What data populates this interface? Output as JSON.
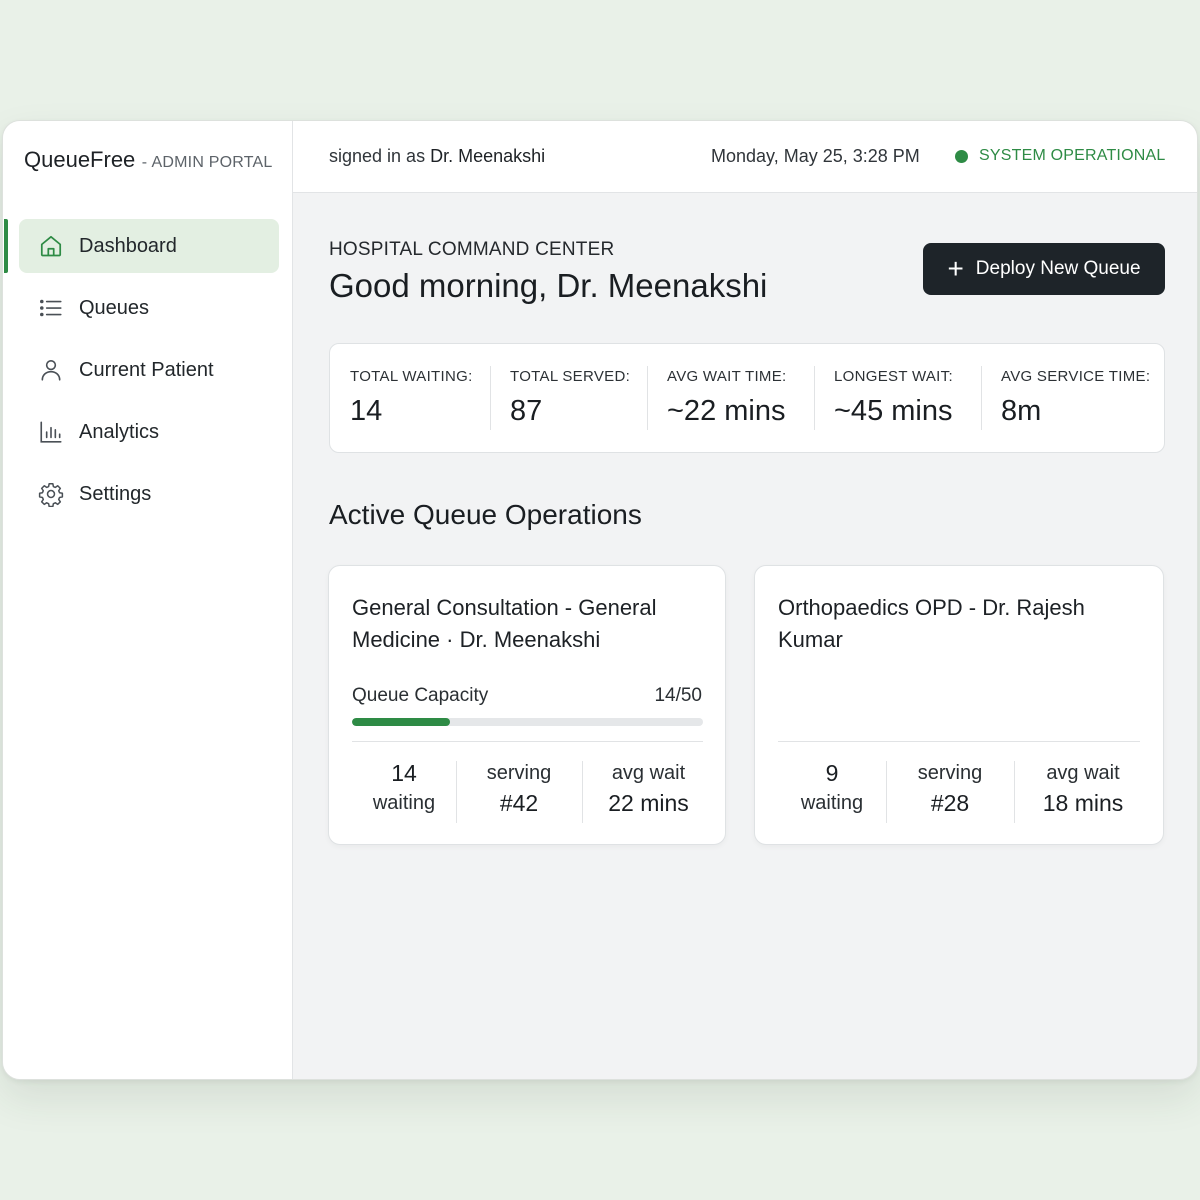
{
  "app": {
    "name": "QueueFree",
    "separator": "-",
    "portal": "ADMIN PORTAL"
  },
  "sidebar": {
    "items": [
      {
        "label": "Dashboard",
        "icon": "home-icon",
        "active": true
      },
      {
        "label": "Queues",
        "icon": "list-icon",
        "active": false
      },
      {
        "label": "Current Patient",
        "icon": "user-icon",
        "active": false
      },
      {
        "label": "Analytics",
        "icon": "bar-chart-icon",
        "active": false
      },
      {
        "label": "Settings",
        "icon": "gear-icon",
        "active": false
      }
    ]
  },
  "topbar": {
    "signed_prefix": "signed in as",
    "signed_user": "Dr. Meenakshi",
    "datetime": "Monday, May 25, 3:28 PM",
    "status": "SYSTEM OPERATIONAL"
  },
  "header": {
    "eyebrow": "HOSPITAL COMMAND CENTER",
    "greeting": "Good morning, Dr. Meenakshi",
    "deploy_label": "Deploy New Queue"
  },
  "stats": [
    {
      "label": "TOTAL WAITING:",
      "value": "14"
    },
    {
      "label": "TOTAL SERVED:",
      "value": "87"
    },
    {
      "label": "AVG WAIT TIME:",
      "value": "~22 mins"
    },
    {
      "label": "LONGEST WAIT:",
      "value": "~45 mins"
    },
    {
      "label": "AVG SERVICE TIME:",
      "value": "8m"
    }
  ],
  "section_title": "Active Queue Operations",
  "queues": [
    {
      "title": "General Consultation - General Medicine · Dr. Meenakshi",
      "capacity_label": "Queue Capacity",
      "capacity_value": "14/50",
      "capacity_fraction": 0.28,
      "waiting_count": "14",
      "waiting_label": "waiting",
      "serving_label": "serving",
      "serving_value": "#42",
      "avg_label": "avg wait",
      "avg_value": "22 mins"
    },
    {
      "title": "Orthopaedics OPD - Dr. Rajesh Kumar",
      "waiting_count": "9",
      "waiting_label": "waiting",
      "serving_label": "serving",
      "serving_value": "#28",
      "avg_label": "avg wait",
      "avg_value": "18 mins"
    }
  ],
  "colors": {
    "accent": "#2e8b45",
    "active_bg": "#e3efe2",
    "button_bg": "#1e2429",
    "page_bg": "#e9f1e8"
  }
}
